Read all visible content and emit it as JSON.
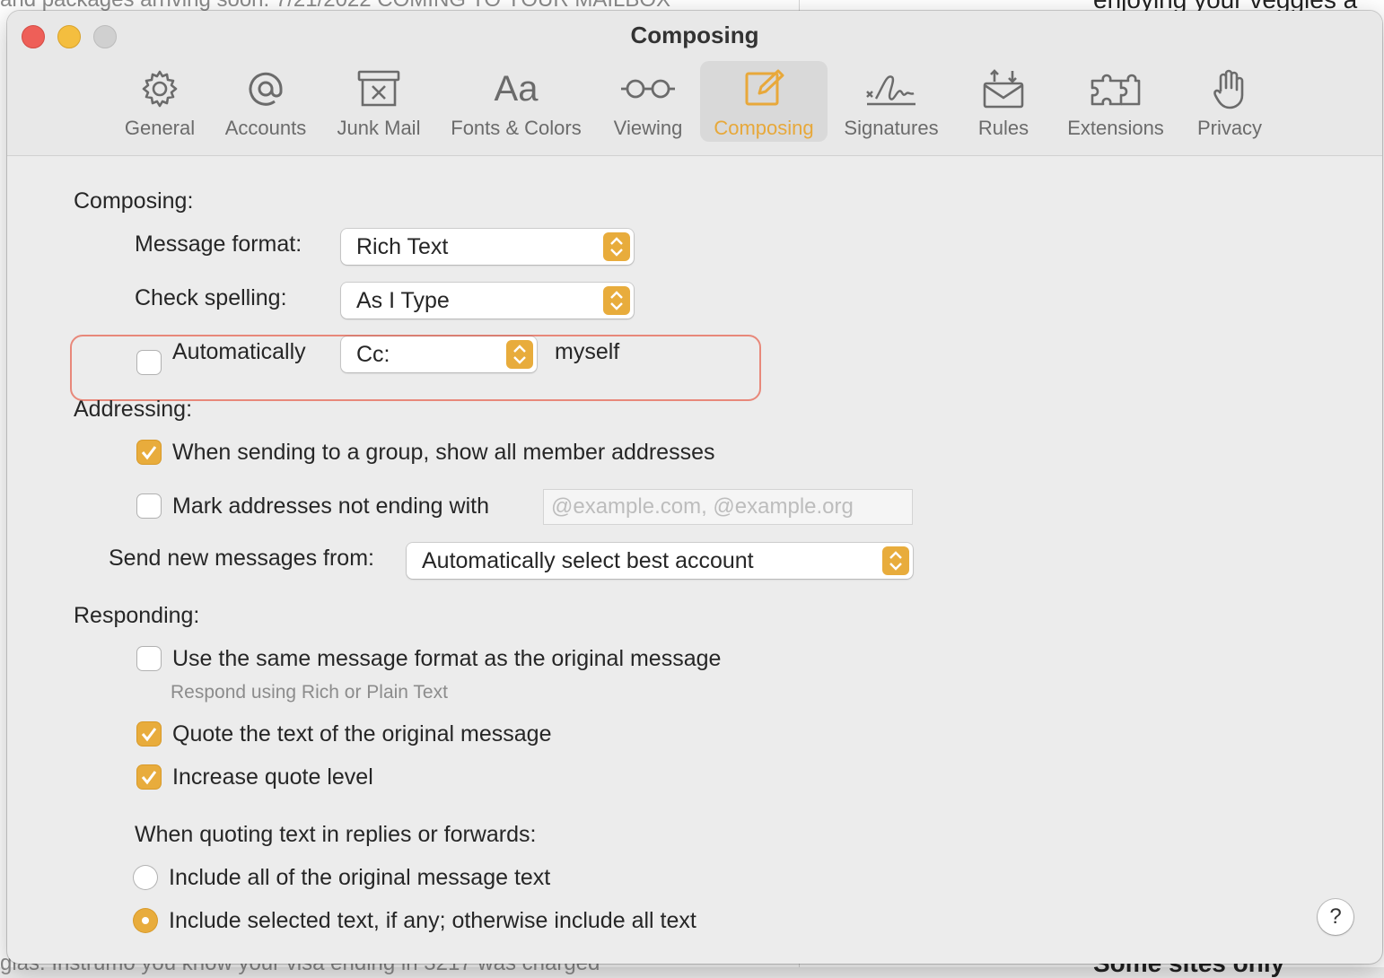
{
  "background": {
    "top_snippet": "and packages arriving soon. 7/21/2022 COMING TO YOUR MAILBOX",
    "right_snippet": "enjoying your veggies a",
    "bottom_snippet": "glas. Instrumo you know your visa ending in 3217 was charged",
    "bottom_right_snippet": "Some sites only"
  },
  "window": {
    "title": "Composing"
  },
  "toolbar": {
    "items": [
      {
        "label": "General",
        "icon": "gear-icon"
      },
      {
        "label": "Accounts",
        "icon": "at-sign-icon"
      },
      {
        "label": "Junk Mail",
        "icon": "junk-bin-icon"
      },
      {
        "label": "Fonts & Colors",
        "icon": "fonts-icon"
      },
      {
        "label": "Viewing",
        "icon": "glasses-icon"
      },
      {
        "label": "Composing",
        "icon": "compose-icon",
        "selected": true
      },
      {
        "label": "Signatures",
        "icon": "signature-icon"
      },
      {
        "label": "Rules",
        "icon": "rules-envelope-icon"
      },
      {
        "label": "Extensions",
        "icon": "puzzle-icon"
      },
      {
        "label": "Privacy",
        "icon": "hand-icon"
      }
    ]
  },
  "composing": {
    "heading": "Composing:",
    "message_format_label": "Message format:",
    "message_format_value": "Rich Text",
    "check_spelling_label": "Check spelling:",
    "check_spelling_value": "As I Type",
    "auto_cc_label": "Automatically",
    "auto_cc_checked": false,
    "auto_cc_value": "Cc:",
    "auto_cc_suffix": "myself"
  },
  "addressing": {
    "heading": "Addressing:",
    "show_all_members_label": "When sending to a group, show all member addresses",
    "show_all_members_checked": true,
    "mark_addresses_label": "Mark addresses not ending with",
    "mark_addresses_checked": false,
    "mark_addresses_placeholder": "@example.com, @example.org",
    "send_from_label": "Send new messages from:",
    "send_from_value": "Automatically select best account"
  },
  "responding": {
    "heading": "Responding:",
    "same_format_label": "Use the same message format as the original message",
    "same_format_checked": false,
    "same_format_hint": "Respond using Rich or Plain Text",
    "quote_text_label": "Quote the text of the original message",
    "quote_text_checked": true,
    "increase_quote_label": "Increase quote level",
    "increase_quote_checked": true,
    "quoting_heading": "When quoting text in replies or forwards:",
    "include_all_label": "Include all of the original message text",
    "include_selected_label": "Include selected text, if any; otherwise include all text",
    "selected_option": "include_selected"
  },
  "help": {
    "label": "?"
  },
  "colors": {
    "accent": "#e8ac3c",
    "highlight_border": "#e8887a"
  }
}
